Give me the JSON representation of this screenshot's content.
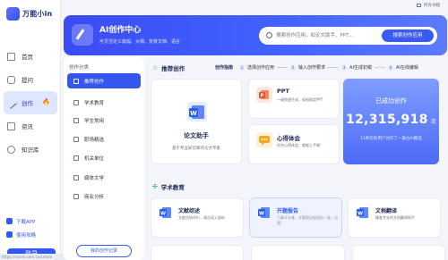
{
  "app": {
    "name": "万能小in"
  },
  "topbar": {
    "link": "所有书籍"
  },
  "sidebar": {
    "items": [
      {
        "label": "首页",
        "icon": "home-icon"
      },
      {
        "label": "提问",
        "icon": "chat-icon"
      },
      {
        "label": "创作",
        "icon": "pen-icon",
        "badge": "🔥"
      },
      {
        "label": "资讯",
        "icon": "document-icon"
      },
      {
        "label": "知识库",
        "icon": "globe-icon"
      }
    ],
    "download": "下载APP",
    "guide": "使用攻略",
    "login": "登录"
  },
  "banner": {
    "title": "AI创作中心",
    "subtitle": "可灵活定义篇幅、大纲、背景文档、语言",
    "search_placeholder": "搜索创作应用，如论文助手、PPT...",
    "search_button": "搜索创作应用"
  },
  "categories": {
    "title": "创作分类",
    "items": [
      {
        "label": "推荐创作"
      },
      {
        "label": "学术教育"
      },
      {
        "label": "学生常用"
      },
      {
        "label": "职场精选"
      },
      {
        "label": "机关单位"
      },
      {
        "label": "媒体文学"
      },
      {
        "label": "商业分析"
      }
    ],
    "records": "我的创作记录"
  },
  "recommended": {
    "title": "推荐创作",
    "guide_title": "创作指南",
    "steps": [
      "选择创作应用",
      "输入创作要求",
      "AI生成初稿",
      "AI在线编辑"
    ],
    "featured": {
      "title": "论文助手",
      "desc": "基于专业知识库的论文专家"
    },
    "cards": [
      {
        "title": "PPT",
        "desc": "一键快速生成，轻松搞定PPT"
      },
      {
        "title": "心得体会",
        "desc": "任何心得体会，都能上手做!"
      }
    ],
    "stats": {
      "label": "已成功创作",
      "value": "12,315,918",
      "unit": "次",
      "desc": "11秒前有用户创作了一篇古AI圈选"
    }
  },
  "education": {
    "title": "学术教育",
    "cards": [
      {
        "title": "文献综述",
        "desc": "文献总结评价，观点深入剖析"
      },
      {
        "title": "开题报告",
        "desc": "万事开头难，开题报告轻轻松一身，点我!"
      },
      {
        "title": "文档翻译",
        "desc": "精准专业的文档翻译助手"
      }
    ]
  },
  "status": {
    "url": "https://xiaoin.com.cn/create"
  },
  "colors": {
    "brand": "#3a5af7",
    "accent_green": "#2e9b6b",
    "fire": "#ef4d2d"
  }
}
